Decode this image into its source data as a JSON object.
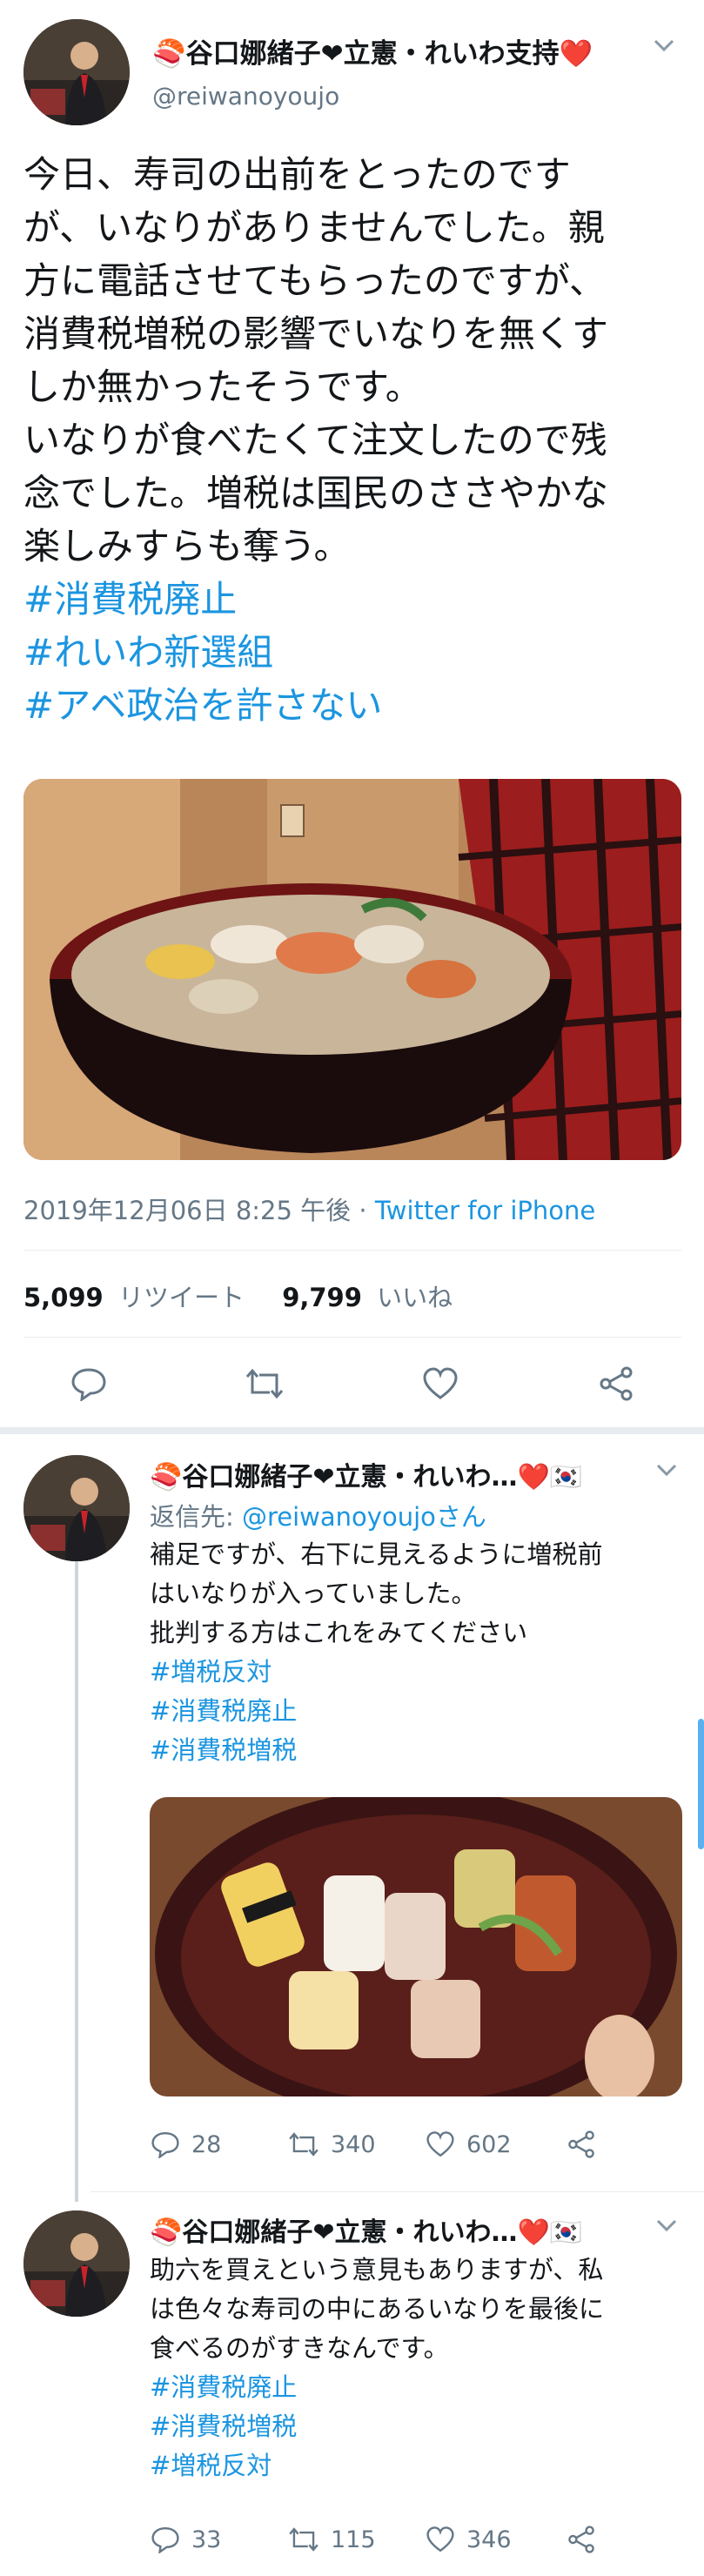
{
  "main_tweet": {
    "display_name": "🍣谷口娜緒子❤立憲・れいわ支持❤️",
    "handle": "@reiwanoyoujo",
    "body_lines": [
      "今日、寿司の出前をとったのです",
      "が、いなりがありませんでした。親",
      "方に電話させてもらったのですが、",
      "消費税増税の影響でいなりを無くす",
      "しか無かったそうです。",
      "いなりが食べたくて注文したので残",
      "念でした。増税は国民のささやかな",
      "楽しみすらも奪う。"
    ],
    "hashtags": [
      "#消費税廃止",
      "#れいわ新選組",
      "#アベ政治を許さない"
    ],
    "timestamp": "2019年12月06日 8:25 午後 · ",
    "source": "Twitter for iPhone",
    "retweets": "5,099",
    "retweets_label": "リツイート",
    "likes": "9,799",
    "likes_label": "いいね"
  },
  "reply1": {
    "display_name": "🍣谷口娜緒子❤立憲・れいわ…❤️🇰🇷",
    "reply_to_label": "返信先: ",
    "reply_to_handle": "@reiwanoyoujoさん",
    "body_lines": [
      "補足ですが、右下に見えるように増税前",
      "はいなりが入っていました。",
      "批判する方はこれをみてください"
    ],
    "hashtags": [
      "#増税反対",
      "#消費税廃止",
      "#消費税増税"
    ],
    "replies": "28",
    "retweets": "340",
    "likes": "602"
  },
  "reply2": {
    "display_name": "🍣谷口娜緒子❤立憲・れいわ…❤️🇰🇷",
    "body_lines": [
      "助六を買えという意見もありますが、私",
      "は色々な寿司の中にあるいなりを最後に",
      "食べるのがすきなんです。"
    ],
    "hashtags": [
      "#消費税廃止",
      "#消費税増税",
      "#増税反対"
    ],
    "replies": "33",
    "retweets": "115",
    "likes": "346"
  },
  "icons": [
    "chevron-down-icon",
    "reply-icon",
    "retweet-icon",
    "like-icon",
    "share-icon"
  ],
  "colors": {
    "hashtag": "#1b95e0",
    "muted": "#657786",
    "thread": "#ccd6dd"
  }
}
